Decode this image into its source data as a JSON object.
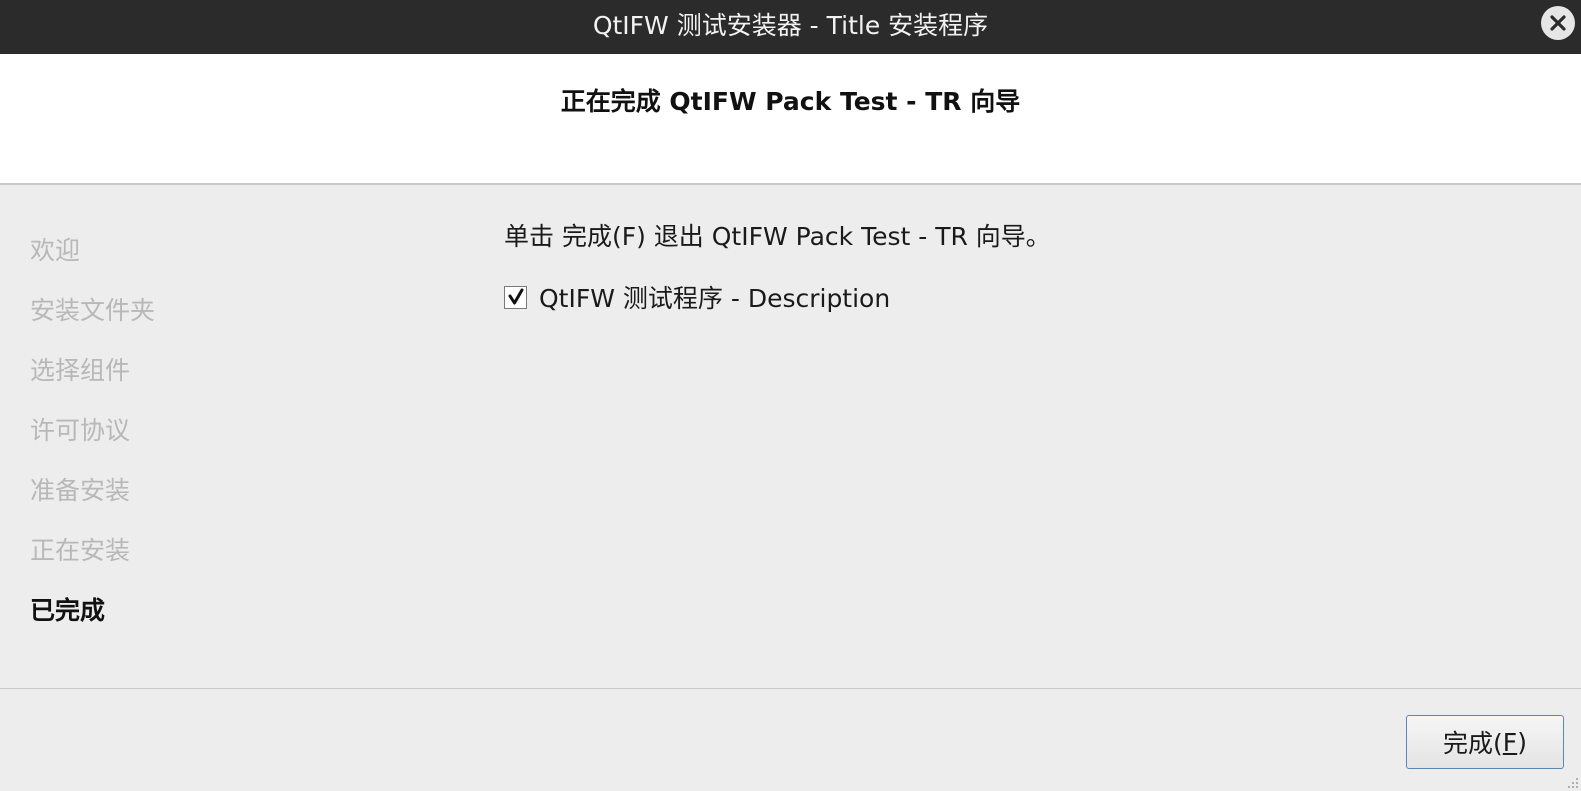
{
  "window": {
    "title": "QtIFW 测试安装器 - Title 安装程序"
  },
  "header": {
    "page_title": "正在完成 QtIFW Pack Test - TR 向导"
  },
  "sidebar": {
    "steps": [
      {
        "label": "欢迎",
        "current": false
      },
      {
        "label": "安装文件夹",
        "current": false
      },
      {
        "label": "选择组件",
        "current": false
      },
      {
        "label": "许可协议",
        "current": false
      },
      {
        "label": "准备安装",
        "current": false
      },
      {
        "label": "正在安装",
        "current": false
      },
      {
        "label": "已完成",
        "current": true
      }
    ]
  },
  "content": {
    "message": "单击 完成(F) 退出 QtIFW Pack Test - TR 向导。",
    "run_program_checkbox": {
      "label": "QtIFW 测试程序 - Description",
      "checked": true
    }
  },
  "footer": {
    "finish_button": {
      "label_before": "完成(",
      "mnemonic": "F",
      "label_after": ")"
    }
  },
  "colors": {
    "titlebar": "#2b2b2b",
    "background": "#ededed",
    "header_background": "#ffffff",
    "inactive_step": "#b8b8b8",
    "button_border": "#5a87b5"
  },
  "icons": {
    "close": "close-icon",
    "check": "checkmark-icon",
    "resize": "resize-grip-icon"
  }
}
